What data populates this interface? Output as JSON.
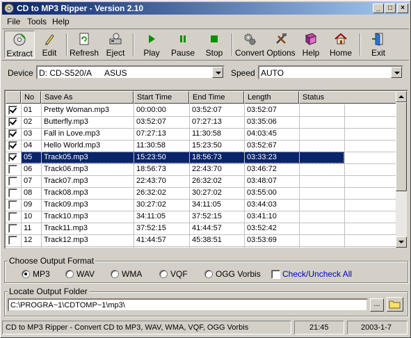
{
  "window": {
    "title": "CD to MP3 Ripper - Version 2.10"
  },
  "menu": {
    "items": [
      {
        "label": "File"
      },
      {
        "label": "Tools"
      },
      {
        "label": "Help"
      }
    ]
  },
  "toolbar": {
    "extract": "Extract",
    "edit": "Edit",
    "refresh": "Refresh",
    "eject": "Eject",
    "play": "Play",
    "pause": "Pause",
    "stop": "Stop",
    "convert": "Convert",
    "options": "Options",
    "help": "Help",
    "home": "Home",
    "exit": "Exit"
  },
  "device": {
    "label": "Device",
    "drive": "D: CD-S520/A",
    "vendor": "ASUS",
    "speed_label": "Speed",
    "speed": "AUTO"
  },
  "tracks": {
    "columns": [
      "No",
      "Save As",
      "Start Time",
      "End Time",
      "Length",
      "Status"
    ],
    "rows": [
      {
        "checked": true,
        "no": "01",
        "save_as": "Pretty Woman.mp3",
        "start": "00:00:00",
        "end": "03:52:07",
        "length": "03:52:07",
        "status": ""
      },
      {
        "checked": true,
        "no": "02",
        "save_as": "Butterfly.mp3",
        "start": "03:52:07",
        "end": "07:27:13",
        "length": "03:35:06",
        "status": ""
      },
      {
        "checked": true,
        "no": "03",
        "save_as": "Fall in Love.mp3",
        "start": "07:27:13",
        "end": "11:30:58",
        "length": "04:03:45",
        "status": ""
      },
      {
        "checked": true,
        "no": "04",
        "save_as": "Hello World.mp3",
        "start": "11:30:58",
        "end": "15:23:50",
        "length": "03:52:67",
        "status": ""
      },
      {
        "checked": true,
        "no": "05",
        "save_as": "Track05.mp3",
        "start": "15:23:50",
        "end": "18:56:73",
        "length": "03:33:23",
        "status": "",
        "selected": true
      },
      {
        "checked": false,
        "no": "06",
        "save_as": "Track06.mp3",
        "start": "18:56:73",
        "end": "22:43:70",
        "length": "03:46:72",
        "status": ""
      },
      {
        "checked": false,
        "no": "07",
        "save_as": "Track07.mp3",
        "start": "22:43:70",
        "end": "26:32:02",
        "length": "03:48:07",
        "status": ""
      },
      {
        "checked": false,
        "no": "08",
        "save_as": "Track08.mp3",
        "start": "26:32:02",
        "end": "30:27:02",
        "length": "03:55:00",
        "status": ""
      },
      {
        "checked": false,
        "no": "09",
        "save_as": "Track09.mp3",
        "start": "30:27:02",
        "end": "34:11:05",
        "length": "03:44:03",
        "status": ""
      },
      {
        "checked": false,
        "no": "10",
        "save_as": "Track10.mp3",
        "start": "34:11:05",
        "end": "37:52:15",
        "length": "03:41:10",
        "status": ""
      },
      {
        "checked": false,
        "no": "11",
        "save_as": "Track11.mp3",
        "start": "37:52:15",
        "end": "41:44:57",
        "length": "03:52:42",
        "status": ""
      },
      {
        "checked": false,
        "no": "12",
        "save_as": "Track12.mp3",
        "start": "41:44:57",
        "end": "45:38:51",
        "length": "03:53:69",
        "status": ""
      }
    ]
  },
  "output_format": {
    "title": "Choose Output Format",
    "options": [
      "MP3",
      "WAV",
      "WMA",
      "VQF",
      "OGG Vorbis"
    ],
    "selected": "MP3",
    "check_all": "Check/Uncheck All"
  },
  "output_folder": {
    "title": "Locate Output Folder",
    "path": "C:\\PROGRA~1\\CDTOMP~1\\mp3\\",
    "browse": "..."
  },
  "statusbar": {
    "message": "CD to MP3 Ripper - Convert CD to MP3, WAV, WMA, VQF, OGG Vorbis",
    "time": "21:45",
    "date": "2003-1-7"
  },
  "colors": {
    "title_start": "#0a246a",
    "title_end": "#a6caf0",
    "selection": "#0a246a",
    "link": "#0000cc"
  }
}
